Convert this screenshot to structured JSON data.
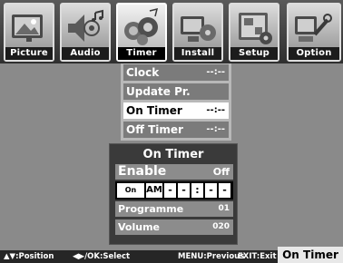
{
  "tabs": [
    {
      "label": "Picture",
      "icon": "picture-icon"
    },
    {
      "label": "Audio",
      "icon": "audio-icon"
    },
    {
      "label": "Timer",
      "icon": "timer-icon",
      "active": true
    },
    {
      "label": "Install",
      "icon": "install-icon"
    },
    {
      "label": "Setup",
      "icon": "setup-icon"
    },
    {
      "label": "Option",
      "icon": "option-icon"
    }
  ],
  "submenu": {
    "items": [
      {
        "label": "Clock",
        "value": "--:--"
      },
      {
        "label": "Update Pr.",
        "value": ""
      },
      {
        "label": "On Timer",
        "value": "--:--",
        "selected": true
      },
      {
        "label": "Off Timer",
        "value": "--:--"
      }
    ]
  },
  "panel": {
    "title": "On Timer",
    "enable_label": "Enable",
    "enable_value": "Off",
    "time_label": "On Time",
    "ampm": "AM",
    "time_digits": [
      "-",
      "-",
      ":",
      "-",
      "-"
    ],
    "programme_label": "Programme",
    "programme_value": "01",
    "volume_label": "Volume",
    "volume_value": "020"
  },
  "help": {
    "position": "▲▼:Position",
    "select": "◀▶/OK:Select",
    "previous": "MENU:Previous",
    "exit": "EXIT:Exit",
    "current": "On Timer"
  }
}
